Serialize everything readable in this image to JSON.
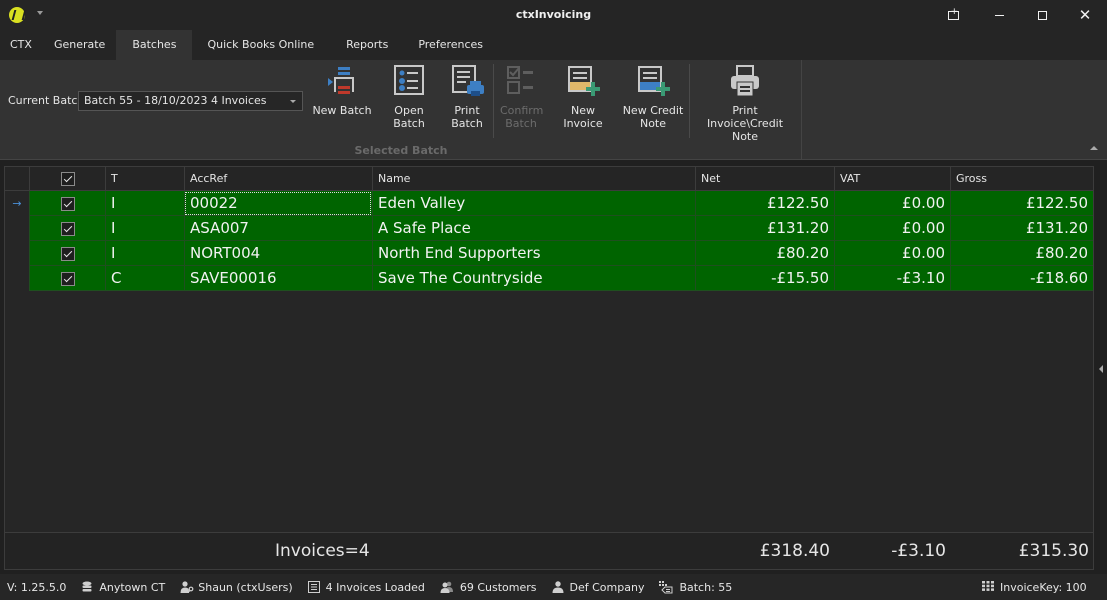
{
  "window": {
    "title": "ctxInvoicing",
    "controls": [
      "pin",
      "minimize",
      "maximize",
      "close"
    ]
  },
  "tabs": [
    {
      "label": "CTX",
      "active": false
    },
    {
      "label": "Generate",
      "active": false
    },
    {
      "label": "Batches",
      "active": true
    },
    {
      "label": "Quick Books Online",
      "active": false
    },
    {
      "label": "Reports",
      "active": false
    },
    {
      "label": "Preferences",
      "active": false
    }
  ],
  "ribbon": {
    "current_batch_label": "Current Batch",
    "current_batch_value": "Batch 55 - 18/10/2023 4 Invoices",
    "group_caption": "Selected Batch",
    "buttons": {
      "new_batch": {
        "line1": "New Batch",
        "line2": "",
        "icon": "new-batch-icon"
      },
      "open_batch": {
        "line1": "Open Batch",
        "line2": "",
        "icon": "open-batch-icon"
      },
      "print_batch": {
        "line1": "Print",
        "line2": "Batch",
        "icon": "print-batch-icon"
      },
      "confirm_batch": {
        "line1": "Confirm",
        "line2": "Batch",
        "icon": "confirm-batch-icon",
        "disabled": true
      },
      "new_invoice": {
        "line1": "New Invoice",
        "line2": "",
        "icon": "new-invoice-icon"
      },
      "new_credit_note": {
        "line1": "New Credit",
        "line2": "Note",
        "icon": "new-credit-note-icon"
      },
      "print_invoice": {
        "line1": "Print",
        "line2": "Invoice\\Credit Note",
        "icon": "printer-icon"
      }
    }
  },
  "grid": {
    "columns": [
      "",
      "T",
      "AccRef",
      "Name",
      "Net",
      "VAT",
      "Gross"
    ],
    "rows": [
      {
        "selected": true,
        "type": "I",
        "accref": "00022",
        "name": "Eden Valley",
        "net": "£122.50",
        "vat": "£0.00",
        "gross": "£122.50",
        "current": true
      },
      {
        "selected": true,
        "type": "I",
        "accref": "ASA007",
        "name": "A Safe Place",
        "net": "£131.20",
        "vat": "£0.00",
        "gross": "£131.20",
        "current": false
      },
      {
        "selected": true,
        "type": "I",
        "accref": "NORT004",
        "name": "North End Supporters",
        "net": "£80.20",
        "vat": "£0.00",
        "gross": "£80.20",
        "current": false
      },
      {
        "selected": true,
        "type": "C",
        "accref": "SAVE00016",
        "name": "Save The Countryside",
        "net": "-£15.50",
        "vat": "-£3.10",
        "gross": "-£18.60",
        "current": false
      }
    ],
    "row_color": "#006400",
    "footer": {
      "count": "Invoices=4",
      "net": "£318.40",
      "vat": "-£3.10",
      "gross": "£315.30"
    }
  },
  "statusbar": {
    "version": "V: 1.25.5.0",
    "database": "Anytown CT",
    "user": "Shaun (ctxUsers)",
    "invoices_loaded": "4 Invoices Loaded",
    "customers": "69 Customers",
    "company": "Def Company",
    "batch": "Batch: 55",
    "invoice_key": "InvoiceKey: 100"
  }
}
